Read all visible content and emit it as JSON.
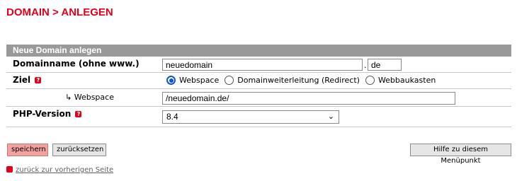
{
  "page": {
    "title": "DOMAIN > ANLEGEN"
  },
  "form": {
    "header": "Neue Domain anlegen",
    "domain": {
      "label": "Domainname (ohne www.)",
      "name_value": "neuedomain",
      "separator": ".",
      "tld_value": "de"
    },
    "ziel": {
      "label": "Ziel",
      "options": [
        {
          "label": "Webspace",
          "checked": true
        },
        {
          "label": "Domainweiterleitung (Redirect)",
          "checked": false
        },
        {
          "label": "Webbaukasten",
          "checked": false
        }
      ]
    },
    "webspace": {
      "label": "↳ Webspace",
      "value": "/neuedomain.de/"
    },
    "php": {
      "label": "PHP-Version",
      "selected": "8.4"
    },
    "help_icon": "help-question-icon"
  },
  "actions": {
    "save_label": "speichern",
    "reset_label": "zurücksetzen",
    "help_label": "Hilfe zu diesem Menüpunkt"
  },
  "back_link": {
    "label": "zurück zur vorherigen Seite"
  },
  "colors": {
    "accent": "#e2001a",
    "header_bg": "#999999",
    "save_bg": "#f2a0a0",
    "radio": "#0b57d0"
  }
}
